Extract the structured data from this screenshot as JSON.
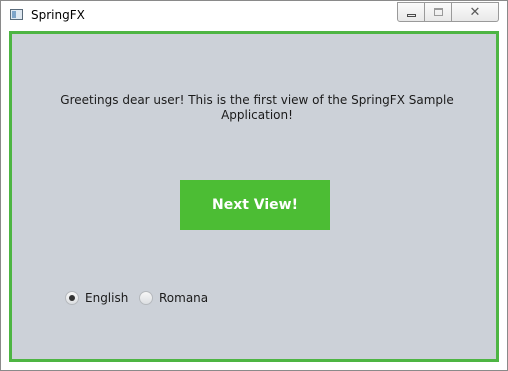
{
  "window": {
    "title": "SpringFX",
    "icon": "app-window-icon",
    "controls": {
      "minimize_icon": "minimize-icon",
      "maximize_icon": "maximize-icon",
      "close_icon": "close-icon",
      "close_glyph": "✕"
    }
  },
  "main": {
    "greeting": "Greetings dear user! This is the first view of the SpringFX Sample Application!",
    "next_button_label": "Next View!",
    "languages": [
      {
        "label": "English",
        "selected": true
      },
      {
        "label": "Romana",
        "selected": false
      }
    ]
  },
  "colors": {
    "accent": "#4cbd34",
    "border": "#4db543",
    "background": "#ccd1d8"
  }
}
